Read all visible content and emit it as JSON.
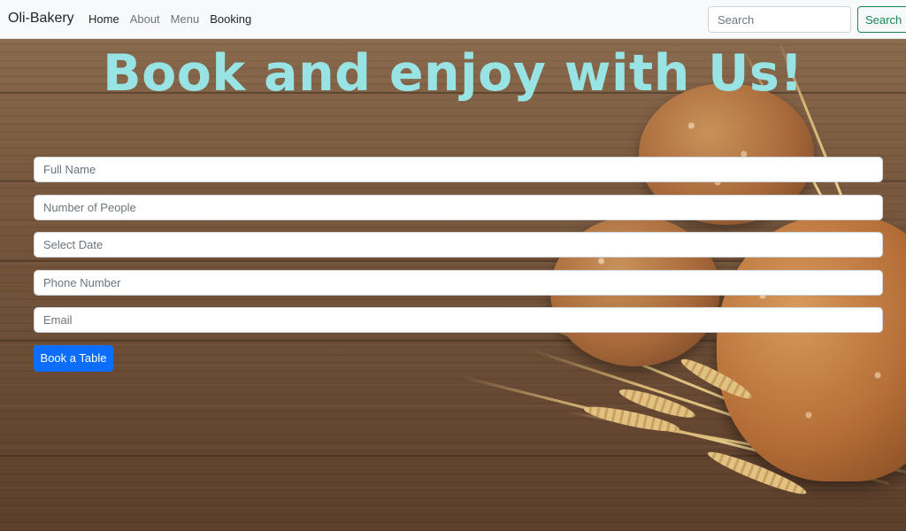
{
  "navbar": {
    "brand": "Oli-Bakery",
    "links": [
      {
        "label": "Home"
      },
      {
        "label": "About"
      },
      {
        "label": "Menu"
      },
      {
        "label": "Booking"
      }
    ],
    "search": {
      "placeholder": "Search",
      "button_label": "Search"
    }
  },
  "hero": {
    "headline": "Book and enjoy with Us!",
    "headline_color": "#98e3e3"
  },
  "form": {
    "fields": [
      {
        "placeholder": "Full Name"
      },
      {
        "placeholder": "Number of People"
      },
      {
        "placeholder": "Select Date"
      },
      {
        "placeholder": "Phone Number"
      },
      {
        "placeholder": "Email"
      }
    ],
    "submit_label": "Book a Table"
  },
  "colors": {
    "primary_button": "#0d6efd",
    "search_button": "#198754",
    "navbar_bg": "#f8f9fa"
  }
}
